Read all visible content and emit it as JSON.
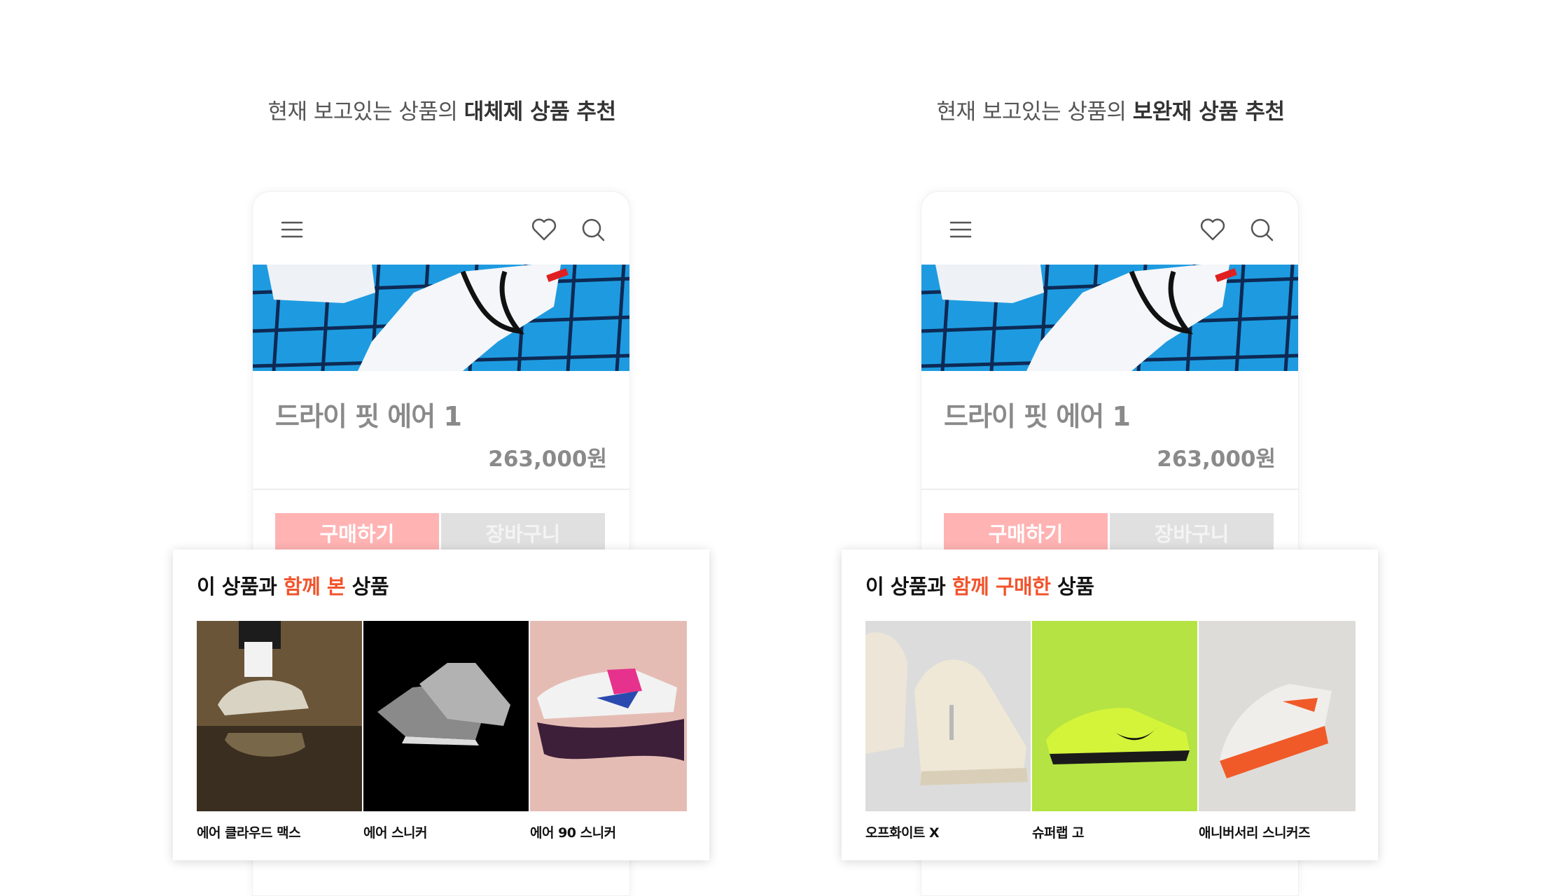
{
  "panels": [
    {
      "heading_prefix": "현재 보고있는 상품의 ",
      "heading_bold": "대체제 상품 추천",
      "product_name": "드라이 핏 에어 1",
      "product_price": "263,000원",
      "buy_label": "구매하기",
      "cart_label": "장바구니",
      "section_pre": "이 상품과 ",
      "section_highlight": "함께 본",
      "section_post": " 상품",
      "items": [
        {
          "label": "에어 클라우드 맥스"
        },
        {
          "label": "에어 스니커"
        },
        {
          "label": "에어 90 스니커"
        }
      ]
    },
    {
      "heading_prefix": "현재 보고있는 상품의 ",
      "heading_bold": "보완재 상품 추천",
      "product_name": "드라이 핏 에어 1",
      "product_price": "263,000원",
      "buy_label": "구매하기",
      "cart_label": "장바구니",
      "section_pre": "이 상품과 ",
      "section_highlight": "함께 구매한",
      "section_post": " 상품",
      "items": [
        {
          "label": "오프화이트 X"
        },
        {
          "label": "슈퍼랩 고"
        },
        {
          "label": "애니버서리 스니커즈"
        }
      ]
    }
  ],
  "colors": {
    "accent": "#f2542d",
    "buy_button": "#ffb3b3",
    "cart_button": "#e0e0e0",
    "hero_blue": "#1e9be0"
  },
  "icons": [
    "menu-icon",
    "heart-icon",
    "search-icon"
  ]
}
